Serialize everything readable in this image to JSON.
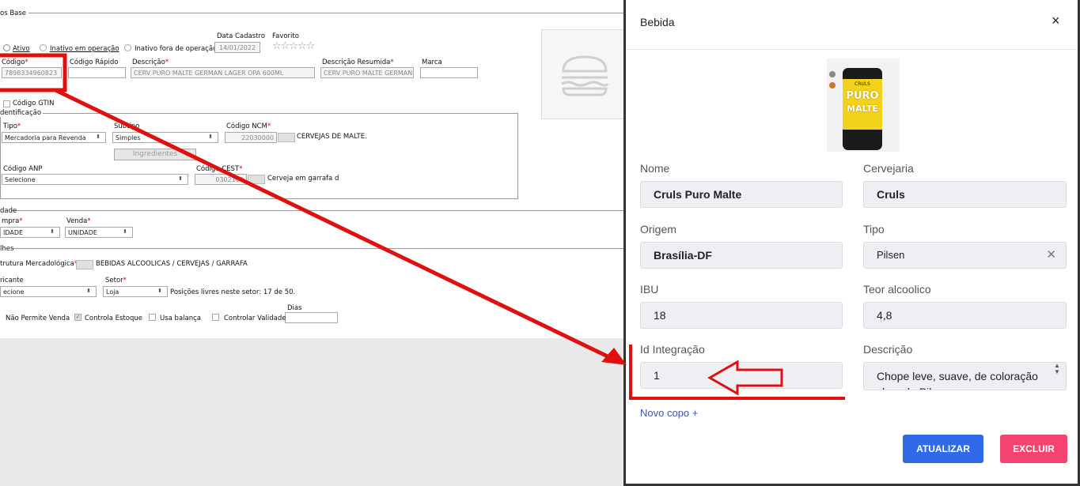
{
  "form": {
    "section_base": "os Base",
    "status": {
      "ativo": "Ativo",
      "inativo_operacao": "Inativo em operação",
      "inativo_fora": "Inativo fora de operação"
    },
    "data_cadastro_label": "Data Cadastro",
    "data_cadastro_value": "14/01/2022",
    "favorito_label": "Favorito",
    "favorito_stars": "☆☆☆☆☆",
    "codigo_label": "Código",
    "codigo_value": "7898334960823",
    "codigo_rapido_label": "Código Rápido",
    "descricao_label": "Descrição",
    "descricao_value": "CERV PURO MALTE GERMAN LAGER OPA 600ML",
    "descricao_resumida_label": "Descrição Resumida",
    "descricao_resumida_value": "CERV PURO MALTE GERMAN",
    "marca_label": "Marca",
    "codigo_gtin_label": "Código GTIN",
    "identificacao_legend": "dentificação",
    "tipo_label": "Tipo",
    "tipo_value": "Mercadoria para Revenda",
    "subtipo_label": "Subtipo",
    "subtipo_value": "Simples",
    "codigo_ncm_label": "Código NCM",
    "codigo_ncm_value": "22030000",
    "ncm_desc": "CERVEJAS DE MALTE.",
    "ingredientes_label": "Ingredientes",
    "codigo_anp_label": "Código ANP",
    "anp_value": "Selecione",
    "codigo_cest_label": "Código CEST",
    "cest_value": "0302100",
    "cest_desc": "Cerveja em garrafa d",
    "unidade_legend": "dade",
    "compra_label": "mpra",
    "compra_value": "IDADE",
    "venda_label": "Venda",
    "venda_value": "UNIDADE",
    "detalhes_legend": "lhes",
    "estrutura_label": "trutura Mercadológica",
    "estrutura_value": "BEBIDAS ALCOOLICAS / CERVEJAS / GARRAFA",
    "fabricante_label": "ricante",
    "fabricante_value": "ecione",
    "setor_label": "Setor",
    "setor_value": "Loja",
    "posicoes_text": "Posições livres neste setor: 17 de 50.",
    "dias_label": "Dias",
    "nao_permite_venda": "Não Permite Venda",
    "controla_estoque": "Controla Estoque",
    "usa_balanca": "Usa balança",
    "controlar_validade": "Controlar Validade"
  },
  "modal": {
    "title": "Bebida",
    "close": "×",
    "can_brand_top": "CRULS",
    "can_brand_main1": "PURO",
    "can_brand_main2": "MALTE",
    "nome_label": "Nome",
    "nome_value": "Cruls Puro Malte",
    "cervejaria_label": "Cervejaria",
    "cervejaria_value": "Cruls",
    "origem_label": "Origem",
    "origem_value": "Brasília-DF",
    "tipo_label": "Tipo",
    "tipo_value": "Pilsen",
    "tipo_clear": "✕",
    "ibu_label": "IBU",
    "ibu_value": "18",
    "teor_label": "Teor alcoolico",
    "teor_value": "4,8",
    "id_integracao_label": "Id Integração",
    "id_integracao_value": "1",
    "descricao_label": "Descrição",
    "descricao_value": "Chope leve, suave, de coloração clara do Pilsen",
    "novo_copo": "Novo copo +",
    "atualizar": "ATUALIZAR",
    "excluir": "EXCLUIR"
  },
  "colors": {
    "annotation_red": "#e01010",
    "primary_blue": "#2f6be8",
    "danger_pink": "#f2446e",
    "link_blue": "#3f51b5"
  }
}
